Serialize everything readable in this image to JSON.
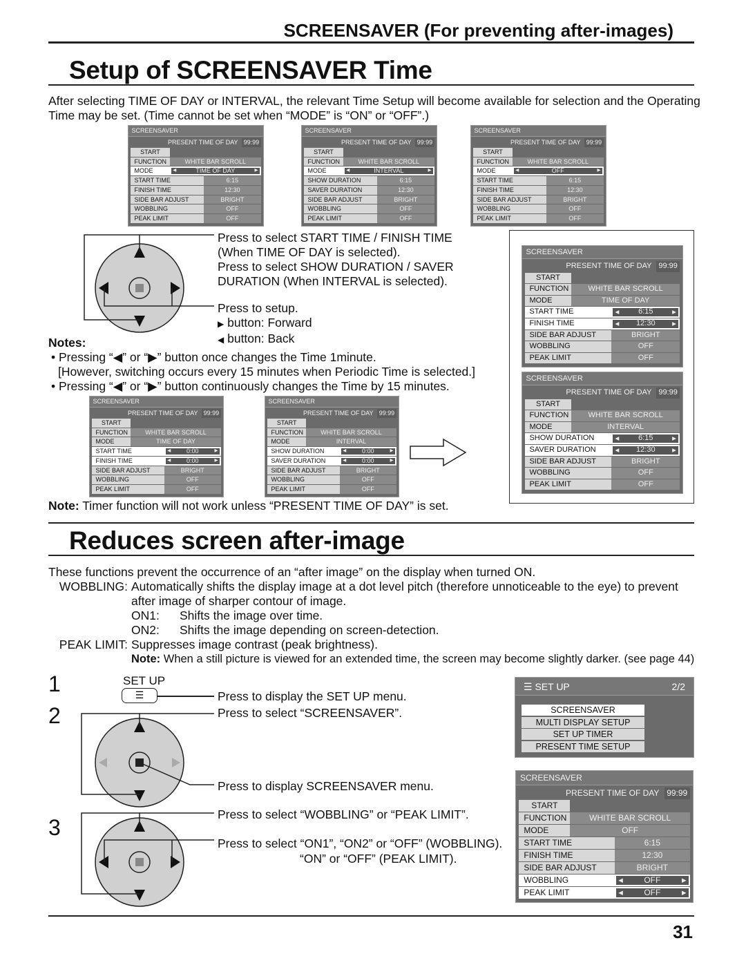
{
  "section_header": "SCREENSAVER (For preventing after-images)",
  "title1": "Setup of SCREENSAVER Time",
  "intro": [
    "After selecting TIME OF DAY or INTERVAL, the relevant Time Setup will become available for selection and the Operating",
    "Time may be set. (Time cannot be set when “MODE” is “ON” or “OFF”.)"
  ],
  "menus": {
    "m1": {
      "title": "SCREENSAVER",
      "present": "PRESENT  TIME OF DAY",
      "clock": "99:99",
      "start": "START",
      "rows": [
        [
          "FUNCTION",
          "WHITE BAR SCROLL",
          "s",
          0
        ],
        [
          "MODE",
          "TIME OF DAY",
          "s",
          1
        ],
        [
          "START TIME",
          "6:15",
          "w",
          0
        ],
        [
          "FINISH TIME",
          "12:30",
          "w",
          0
        ],
        [
          "SIDE BAR ADJUST",
          "BRIGHT",
          "w",
          0
        ],
        [
          "WOBBLING",
          "OFF",
          "w",
          0
        ],
        [
          "PEAK LIMIT",
          "OFF",
          "w",
          0
        ]
      ]
    },
    "m2": {
      "title": "SCREENSAVER",
      "present": "PRESENT  TIME OF DAY",
      "clock": "99:99",
      "start": "START",
      "rows": [
        [
          "FUNCTION",
          "WHITE BAR SCROLL",
          "s",
          0
        ],
        [
          "MODE",
          "INTERVAL",
          "s",
          1
        ],
        [
          "SHOW DURATION",
          "6:15",
          "w",
          0
        ],
        [
          "SAVER DURATION",
          "12:30",
          "w",
          0
        ],
        [
          "SIDE BAR ADJUST",
          "BRIGHT",
          "w",
          0
        ],
        [
          "WOBBLING",
          "OFF",
          "w",
          0
        ],
        [
          "PEAK LIMIT",
          "OFF",
          "w",
          0
        ]
      ]
    },
    "m3": {
      "title": "SCREENSAVER",
      "present": "PRESENT  TIME OF DAY",
      "clock": "99:99",
      "start": "START",
      "rows": [
        [
          "FUNCTION",
          "WHITE BAR SCROLL",
          "s",
          0
        ],
        [
          "MODE",
          "OFF",
          "s",
          1
        ],
        [
          "START TIME",
          "6:15",
          "w",
          0
        ],
        [
          "FINISH TIME",
          "12:30",
          "w",
          0
        ],
        [
          "SIDE BAR ADJUST",
          "BRIGHT",
          "w",
          0
        ],
        [
          "WOBBLING",
          "OFF",
          "w",
          0
        ],
        [
          "PEAK LIMIT",
          "OFF",
          "w",
          0
        ]
      ]
    },
    "m4": {
      "title": "SCREENSAVER",
      "present": "PRESENT  TIME OF DAY",
      "clock": "99:99",
      "start": "START",
      "rows": [
        [
          "FUNCTION",
          "WHITE BAR SCROLL",
          "s",
          0
        ],
        [
          "MODE",
          "TIME OF DAY",
          "s",
          0
        ],
        [
          "START TIME",
          "0:00",
          "w",
          1
        ],
        [
          "FINISH TIME",
          "0:00",
          "w",
          1
        ],
        [
          "SIDE BAR ADJUST",
          "BRIGHT",
          "w",
          0
        ],
        [
          "WOBBLING",
          "OFF",
          "w",
          0
        ],
        [
          "PEAK LIMIT",
          "OFF",
          "w",
          0
        ]
      ]
    },
    "m5": {
      "title": "SCREENSAVER",
      "present": "PRESENT  TIME OF DAY",
      "clock": "99:99",
      "start": "START",
      "rows": [
        [
          "FUNCTION",
          "WHITE BAR SCROLL",
          "s",
          0
        ],
        [
          "MODE",
          "INTERVAL",
          "s",
          0
        ],
        [
          "SHOW DURATION",
          "0:00",
          "w",
          1
        ],
        [
          "SAVER DURATION",
          "0:00",
          "w",
          1
        ],
        [
          "SIDE BAR ADJUST",
          "BRIGHT",
          "w",
          0
        ],
        [
          "WOBBLING",
          "OFF",
          "w",
          0
        ],
        [
          "PEAK LIMIT",
          "OFF",
          "w",
          0
        ]
      ]
    },
    "m6": {
      "title": "SCREENSAVER",
      "present": "PRESENT  TIME OF DAY",
      "clock": "99:99",
      "start": "START",
      "rows": [
        [
          "FUNCTION",
          "WHITE BAR SCROLL",
          "s",
          0
        ],
        [
          "MODE",
          "TIME OF DAY",
          "s",
          0
        ],
        [
          "START TIME",
          "6:15",
          "w",
          1
        ],
        [
          "FINISH TIME",
          "12:30",
          "w",
          1
        ],
        [
          "SIDE BAR ADJUST",
          "BRIGHT",
          "w",
          0
        ],
        [
          "WOBBLING",
          "OFF",
          "w",
          0
        ],
        [
          "PEAK LIMIT",
          "OFF",
          "w",
          0
        ]
      ]
    },
    "m7": {
      "title": "SCREENSAVER",
      "present": "PRESENT  TIME OF DAY",
      "clock": "99:99",
      "start": "START",
      "rows": [
        [
          "FUNCTION",
          "WHITE BAR SCROLL",
          "s",
          0
        ],
        [
          "MODE",
          "INTERVAL",
          "s",
          0
        ],
        [
          "SHOW DURATION",
          "6:15",
          "w",
          1
        ],
        [
          "SAVER DURATION",
          "12:30",
          "w",
          1
        ],
        [
          "SIDE BAR ADJUST",
          "BRIGHT",
          "w",
          0
        ],
        [
          "WOBBLING",
          "OFF",
          "w",
          0
        ],
        [
          "PEAK LIMIT",
          "OFF",
          "w",
          0
        ]
      ]
    },
    "m8": {
      "title": "SCREENSAVER",
      "present": "PRESENT  TIME OF DAY",
      "clock": "99:99",
      "start": "START",
      "rows": [
        [
          "FUNCTION",
          "WHITE BAR SCROLL",
          "s",
          0
        ],
        [
          "MODE",
          "OFF",
          "s",
          0
        ],
        [
          "START TIME",
          "6:15",
          "w",
          0
        ],
        [
          "FINISH TIME",
          "12:30",
          "w",
          0
        ],
        [
          "SIDE BAR ADJUST",
          "BRIGHT",
          "w",
          0
        ],
        [
          "WOBBLING",
          "OFF",
          "w",
          1
        ],
        [
          "PEAK LIMIT",
          "OFF",
          "w",
          1
        ]
      ]
    }
  },
  "pad1": {
    "l1": "Press to select START TIME / FINISH TIME",
    "l2": "(When TIME OF DAY is selected).",
    "l3": "Press  to  select  SHOW  DURATION  /  SAVER",
    "l4": "DURATION (When INTERVAL is selected).",
    "l5": "Press to setup.",
    "l6": "button: Forward",
    "l7": "button: Back"
  },
  "notes": {
    "heading": "Notes:",
    "n1": "• Pressing “◀” or “▶” button once changes the Time 1minute.",
    "n2": "[However, switching occurs every 15 minutes when Periodic Time is selected.]",
    "n3": "• Pressing “◀” or “▶” button continuously changes the Time by 15 minutes."
  },
  "note_timer": {
    "bold": "Note:",
    "text": " Timer function will not work unless “PRESENT TIME OF DAY” is set."
  },
  "title2": "Reduces screen after-image",
  "body2": {
    "p1": "These functions prevent the occurrence of an “after image” on the display when turned ON.",
    "wob_label": "WOBBLING:",
    "wob1": "Automatically shifts the display image at a dot level pitch (therefore unnoticeable to the eye) to prevent",
    "wob2": "after image of sharper contour of image.",
    "on1_k": "ON1:",
    "on1": "Shifts the image over time.",
    "on2_k": "ON2:",
    "on2": "Shifts the image depending on screen-detection.",
    "peak_label": "PEAK LIMIT:",
    "peak": "Suppresses image contrast (peak brightness).",
    "note_bold": "Note:",
    "note": " When a still picture is viewed for an extended time, the screen may become slightly darker. (see page 44)"
  },
  "steps": {
    "s1": "1",
    "s2": "2",
    "s3": "3",
    "setup_btn": "SET UP",
    "t1": "Press to display the SET UP menu.",
    "t2": "Press to select “SCREENSAVER”.",
    "t3": "Press to display SCREENSAVER menu.",
    "t4": "Press to select “WOBBLING” or “PEAK LIMIT”.",
    "t5": "Press to select “ON1”, “ON2” or “OFF” (WOBBLING).",
    "t6": "“ON” or “OFF” (PEAK LIMIT)."
  },
  "setup_menu": {
    "title": "SET UP",
    "page": "2/2",
    "items": [
      "SCREENSAVER",
      "MULTI DISPLAY SETUP",
      "SET UP TIMER",
      "PRESENT TIME SETUP"
    ]
  },
  "page_number": "31"
}
